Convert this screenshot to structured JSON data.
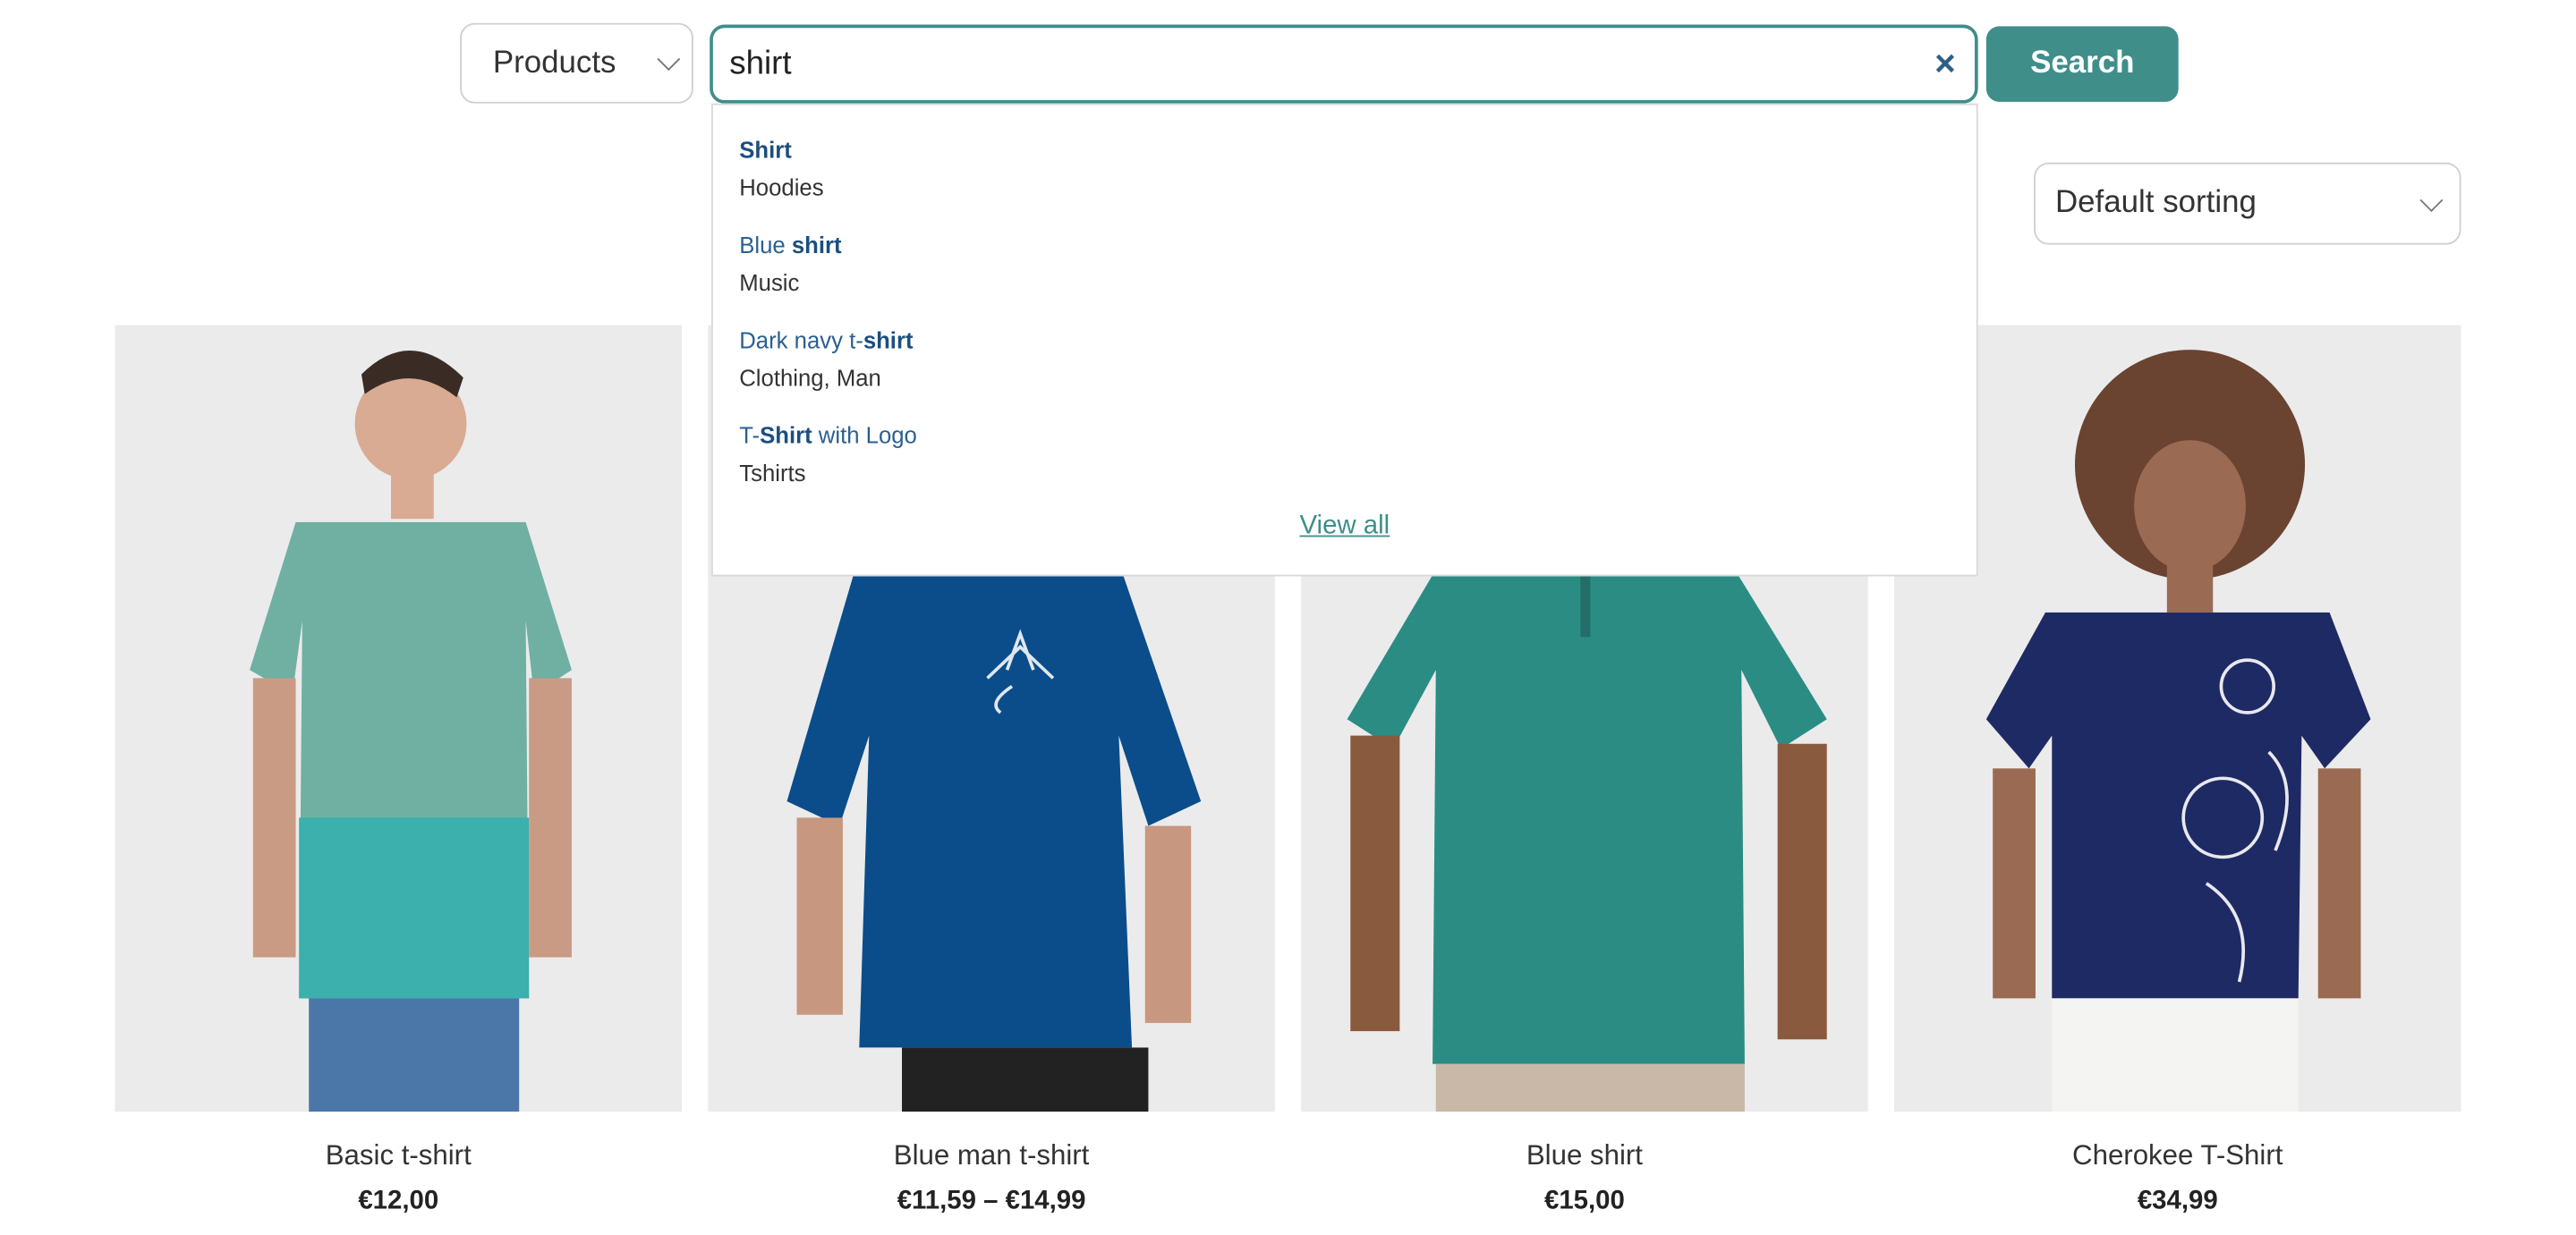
{
  "search": {
    "category": "Products",
    "query": "shirt",
    "clear_glyph": "×",
    "button_label": "Search"
  },
  "sorting": {
    "selected": "Default sorting"
  },
  "suggestions": {
    "items": [
      {
        "pre": "",
        "match": "Shirt",
        "post": "",
        "category": "Hoodies"
      },
      {
        "pre": "Blue ",
        "match": "shirt",
        "post": "",
        "category": "Music"
      },
      {
        "pre": "Dark navy t-",
        "match": "shirt",
        "post": "",
        "category": "Clothing, Man"
      },
      {
        "pre": "T-",
        "match": "Shirt",
        "post": " with Logo",
        "category": "Tshirts"
      }
    ],
    "view_all": "View all"
  },
  "products": [
    {
      "name": "Basic t-shirt",
      "price": "€12,00"
    },
    {
      "name": "Blue man t-shirt",
      "price": "€11,59 – €14,99"
    },
    {
      "name": "Blue shirt",
      "price": "€15,00"
    },
    {
      "name": "Cherokee T-Shirt",
      "price": "€34,99"
    }
  ],
  "colors": {
    "accent": "#3f8e8a",
    "link": "#2a5f92"
  }
}
